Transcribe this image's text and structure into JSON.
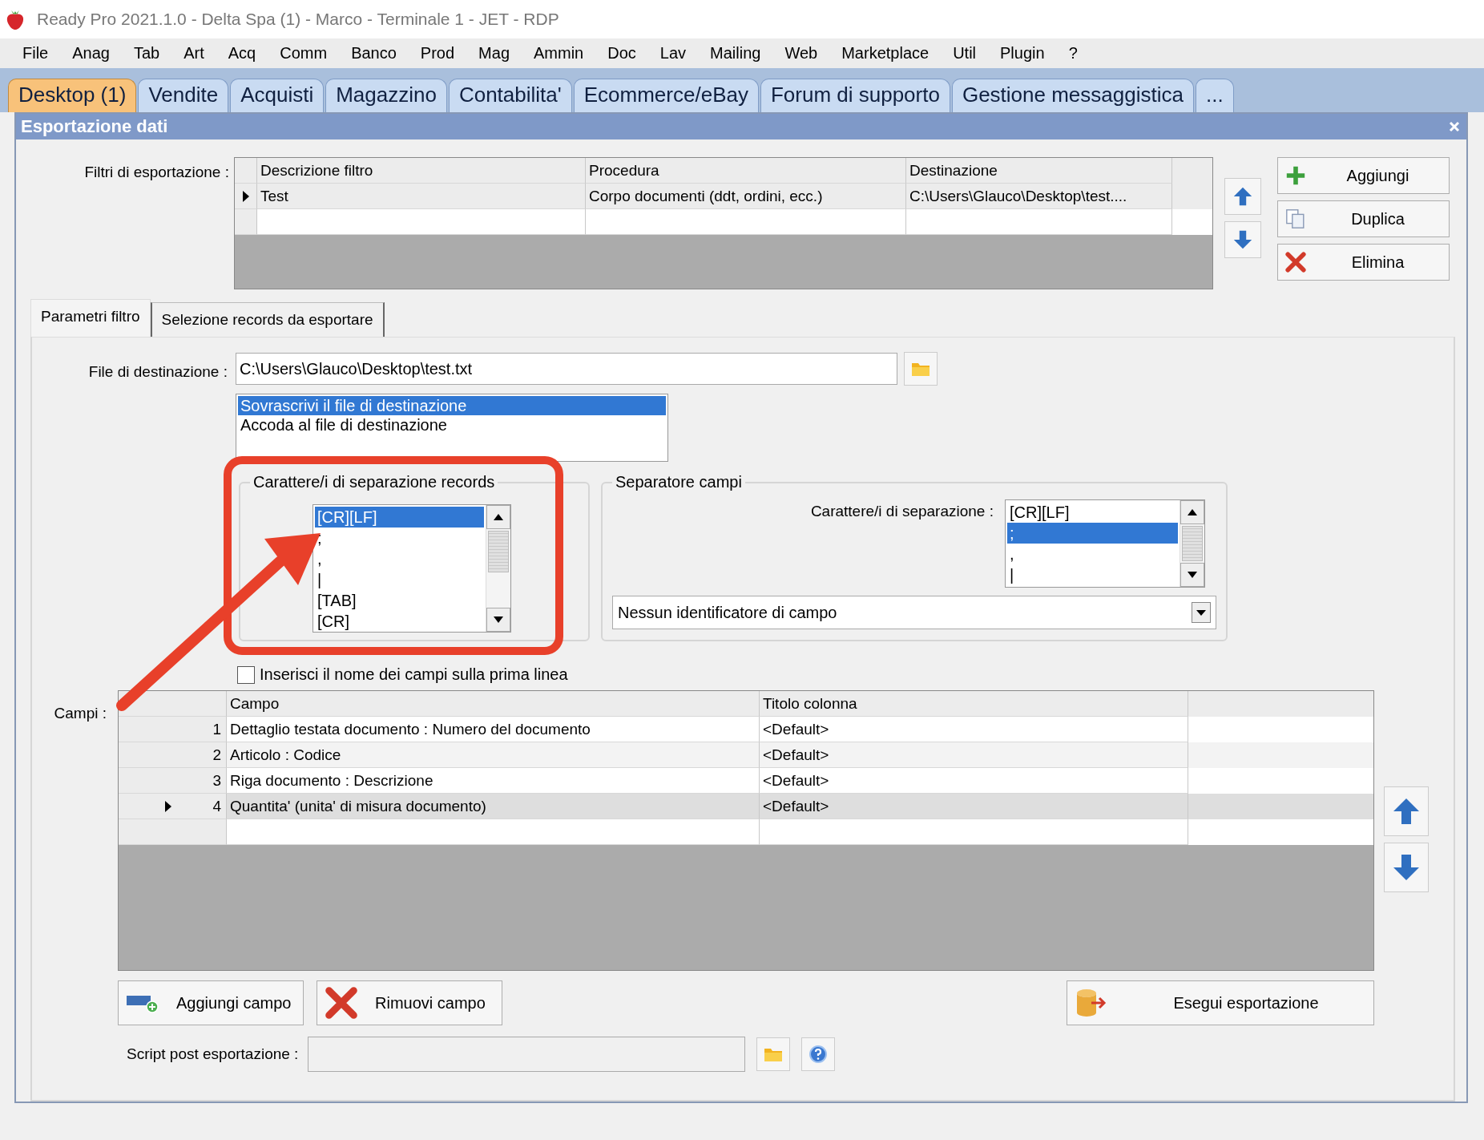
{
  "window": {
    "title": "Ready Pro 2021.1.0 - Delta Spa (1) - Marco - Terminale 1 - JET - RDP"
  },
  "menu": [
    "File",
    "Anag",
    "Tab",
    "Art",
    "Acq",
    "Comm",
    "Banco",
    "Prod",
    "Mag",
    "Ammin",
    "Doc",
    "Lav",
    "Mailing",
    "Web",
    "Marketplace",
    "Util",
    "Plugin",
    "?"
  ],
  "tabs": [
    {
      "label": "Desktop (1)",
      "selected": true
    },
    {
      "label": "Vendite",
      "selected": false
    },
    {
      "label": "Acquisti",
      "selected": false
    },
    {
      "label": "Magazzino",
      "selected": false
    },
    {
      "label": "Contabilita'",
      "selected": false
    },
    {
      "label": "Ecommerce/eBay",
      "selected": false
    },
    {
      "label": "Forum di supporto",
      "selected": false
    },
    {
      "label": "Gestione messaggistica",
      "selected": false
    },
    {
      "label": "...",
      "selected": false
    }
  ],
  "dialog": {
    "title": "Esportazione dati"
  },
  "filters": {
    "label": "Filtri di esportazione :",
    "columns": [
      "Descrizione filtro",
      "Procedura",
      "Destinazione"
    ],
    "rows": [
      {
        "cells": [
          "Test",
          "Corpo documenti (ddt, ordini, ecc.)",
          "C:\\Users\\Glauco\\Desktop\\test...."
        ],
        "current": true
      }
    ]
  },
  "filter_buttons": [
    {
      "label": "Aggiungi",
      "kind": "add"
    },
    {
      "label": "Duplica",
      "kind": "copy"
    },
    {
      "label": "Elimina",
      "kind": "delete"
    }
  ],
  "subtabs": [
    {
      "label": "Parametri filtro",
      "selected": true
    },
    {
      "label": "Selezione records da esportare",
      "selected": false
    }
  ],
  "destination": {
    "label": "File di destinazione :",
    "value": "C:\\Users\\Glauco\\Desktop\\test.txt"
  },
  "write_mode": [
    {
      "label": "Sovrascrivi il file di destinazione",
      "selected": true
    },
    {
      "label": "Accoda al file di destinazione",
      "selected": false
    }
  ],
  "record_separator": {
    "title": "Carattere/i di separazione records",
    "items": [
      {
        "label": "[CR][LF]",
        "selected": true
      },
      {
        "label": ";",
        "selected": false
      },
      {
        "label": ",",
        "selected": false
      },
      {
        "label": "|",
        "selected": false
      },
      {
        "label": "[TAB]",
        "selected": false
      },
      {
        "label": "[CR]",
        "selected": false
      }
    ]
  },
  "field_separator": {
    "title": "Separatore campi",
    "label": "Carattere/i di separazione :",
    "items": [
      {
        "label": "[CR][LF]",
        "selected": false
      },
      {
        "label": ";",
        "selected": true
      },
      {
        "label": ",",
        "selected": false
      },
      {
        "label": "|",
        "selected": false
      }
    ],
    "identifier": "Nessun identificatore di campo"
  },
  "header_checkbox": {
    "label": "Inserisci il nome dei campi sulla prima linea",
    "checked": false
  },
  "fields": {
    "label": "Campi :",
    "columns": [
      "Campo",
      "Titolo colonna"
    ],
    "rows": [
      {
        "number": "1",
        "field": "Dettaglio testata documento : Numero del documento",
        "title": "<Default>",
        "current": false
      },
      {
        "number": "2",
        "field": "Articolo : Codice",
        "title": "<Default>",
        "current": false
      },
      {
        "number": "3",
        "field": "Riga documento : Descrizione",
        "title": "<Default>",
        "current": false
      },
      {
        "number": "4",
        "field": "Quantita' (unita' di misura documento)",
        "title": "<Default>",
        "current": true
      }
    ]
  },
  "actions": [
    {
      "label": "Aggiungi campo",
      "kind": "add"
    },
    {
      "label": "Rimuovi campo",
      "kind": "remove"
    },
    {
      "label": "Esegui esportazione",
      "kind": "run"
    }
  ],
  "script": {
    "label": "Script post esportazione :"
  }
}
